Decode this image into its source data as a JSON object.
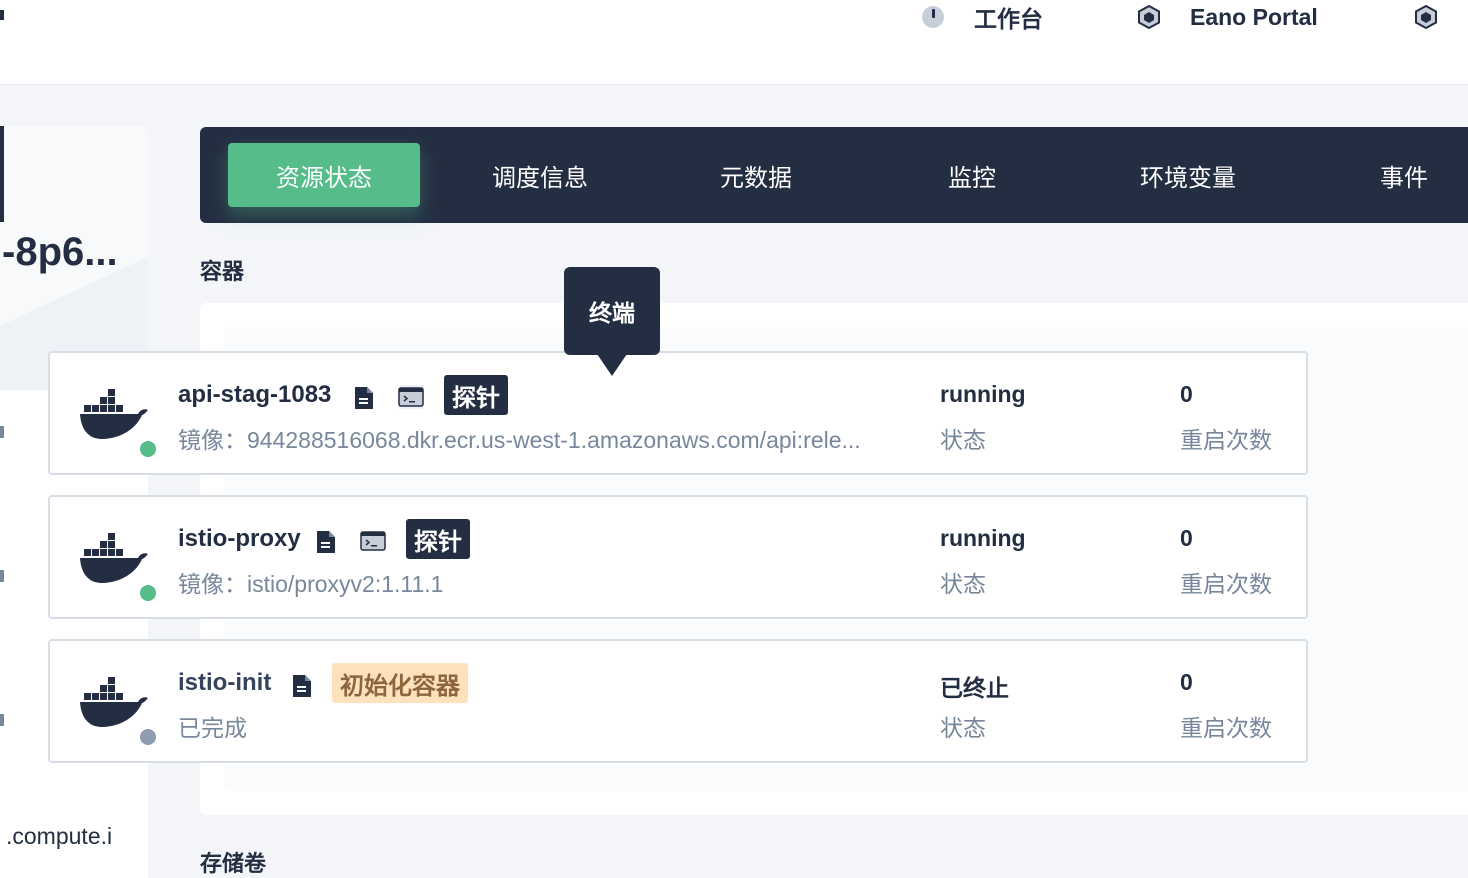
{
  "header": {
    "nav": [
      {
        "label": "工作台",
        "icon": "dashboard-icon"
      },
      {
        "label": "Eano Portal",
        "icon": "cube-icon"
      },
      {
        "label": "",
        "icon": "cube-icon"
      }
    ]
  },
  "left_panel": {
    "title": "-8p6...",
    "footer_text": ".compute.i"
  },
  "tabs": [
    {
      "label": "资源状态",
      "active": true
    },
    {
      "label": "调度信息",
      "active": false
    },
    {
      "label": "元数据",
      "active": false
    },
    {
      "label": "监控",
      "active": false
    },
    {
      "label": "环境变量",
      "active": false
    },
    {
      "label": "事件",
      "active": false
    }
  ],
  "containers_section": {
    "title": "容器",
    "items": [
      {
        "name": "api-stag-1083",
        "sub": "镜像：944288516068.dkr.ecr.us-west-1.amazonaws.com/api:rele...",
        "tag": "探针",
        "tag_type": "probe",
        "has_terminal": true,
        "status_value": "running",
        "status_label": "状态",
        "restart_value": "0",
        "restart_label": "重启次数",
        "dot_color": "#55bc8a"
      },
      {
        "name": "istio-proxy",
        "sub": "镜像：istio/proxyv2:1.11.1",
        "tag": "探针",
        "tag_type": "probe",
        "has_terminal": true,
        "status_value": "running",
        "status_label": "状态",
        "restart_value": "0",
        "restart_label": "重启次数",
        "dot_color": "#55bc8a"
      },
      {
        "name": "istio-init",
        "sub": "已完成",
        "tag": "初始化容器",
        "tag_type": "init",
        "has_terminal": false,
        "status_value": "已终止",
        "status_label": "状态",
        "restart_value": "0",
        "restart_label": "重启次数",
        "dot_color": "#8f9bae"
      }
    ]
  },
  "tooltip": {
    "text": "终端"
  },
  "volumes_section": {
    "title": "存储卷"
  },
  "colors": {
    "dark": "#242e42",
    "accent_green": "#55bc8a",
    "init_tag_bg": "#ffe1be",
    "muted_text": "#79879c"
  }
}
